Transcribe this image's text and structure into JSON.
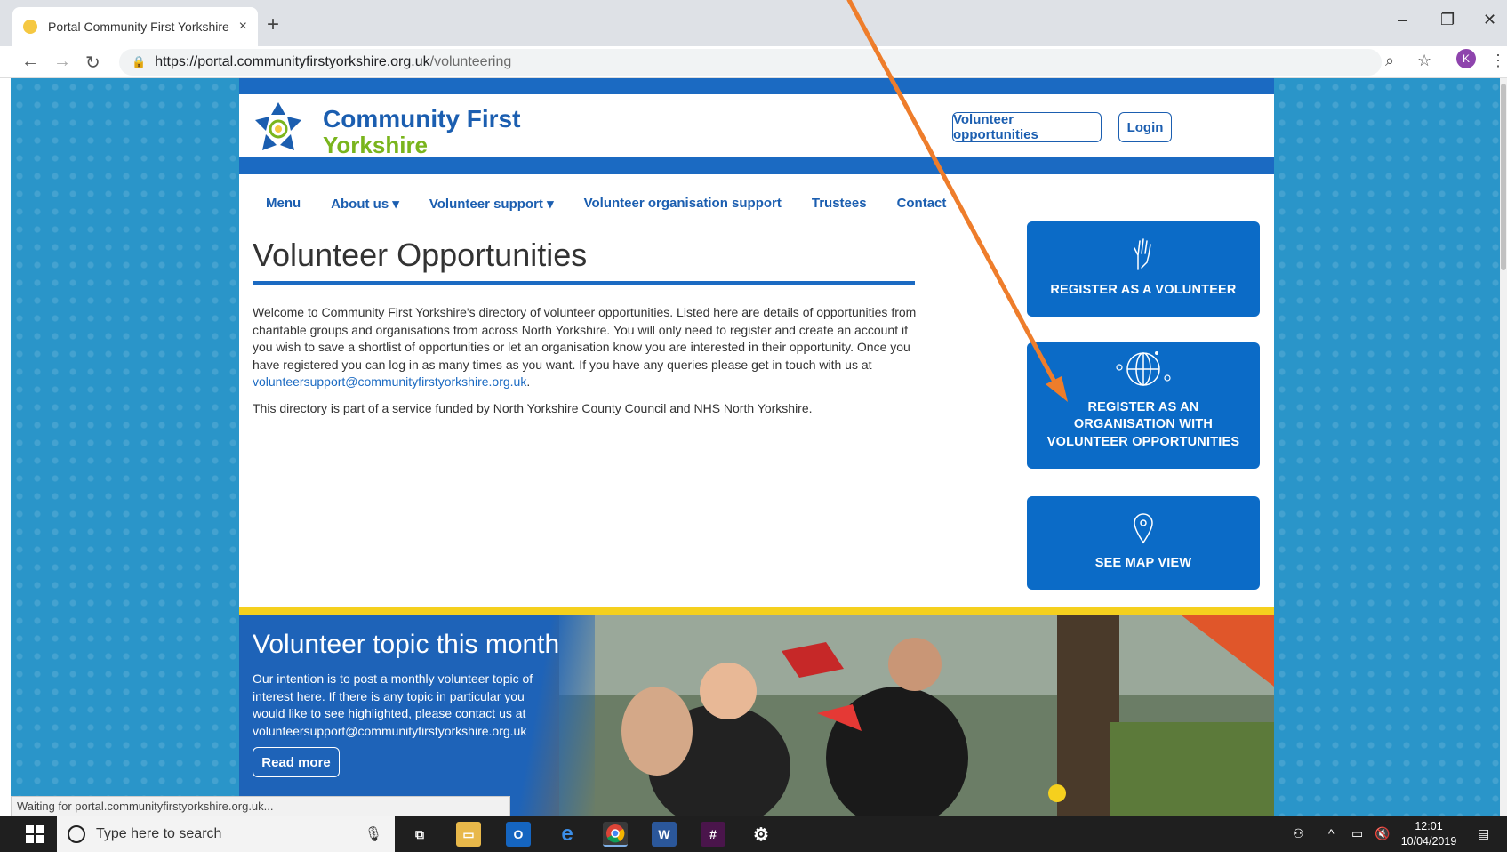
{
  "browser": {
    "tab_title": "Portal Community First Yorkshire",
    "tab_close": "×",
    "new_tab": "+",
    "url_host": "https://portal.communityfirstyorkshire.org.uk",
    "url_path": "/volunteering",
    "profile_initial": "K",
    "status_text": "Waiting for portal.communityfirstyorkshire.org.uk..."
  },
  "header": {
    "brand_line1": "Community First",
    "brand_line2": "Yorkshire",
    "btn_volunteer_opps": "Volunteer opportunities",
    "btn_login": "Login"
  },
  "nav": {
    "items": [
      "Menu",
      "About us ▾",
      "Volunteer support ▾",
      "Volunteer organisation support",
      "Trustees",
      "Contact"
    ]
  },
  "main": {
    "title": "Volunteer Opportunities",
    "para1": "Welcome to Community First Yorkshire's directory of volunteer opportunities.  Listed here are details of opportunities from charitable groups and organisations from across North Yorkshire.  You will only need to register and create an account if you wish to save a shortlist of opportunities or let an organisation know you are interested in their opportunity.  Once you have registered you can log in as many times as you want. If you have any queries please get in touch with us at",
    "email": "volunteersupport@communityfirstyorkshire.org.uk",
    "para1_end": ".",
    "para2": "This directory is part of a service funded by North Yorkshire County Council and NHS North Yorkshire."
  },
  "cards": {
    "register_volunteer": "REGISTER AS A VOLUNTEER",
    "register_org_l1": "REGISTER AS AN",
    "register_org_l2": "ORGANISATION WITH",
    "register_org_l3": "VOLUNTEER OPPORTUNITIES",
    "map_view": "SEE MAP VIEW"
  },
  "hero": {
    "title": "Volunteer topic this month",
    "text": "Our intention is to post a monthly volunteer topic of interest here.  If there is any topic in particular you would like to see highlighted, please contact us at volunteersupport@communityfirstyorkshire.org.uk",
    "read_more": "Read more"
  },
  "taskbar": {
    "search_placeholder": "Type here to search",
    "time": "12:01",
    "date": "10/04/2019"
  },
  "colors": {
    "brand_blue": "#1b6ac2",
    "brand_green": "#7ab51d",
    "card_blue": "#0b6bc7",
    "accent_yellow": "#f5d01e",
    "annotation_orange": "#ee7d2b"
  }
}
